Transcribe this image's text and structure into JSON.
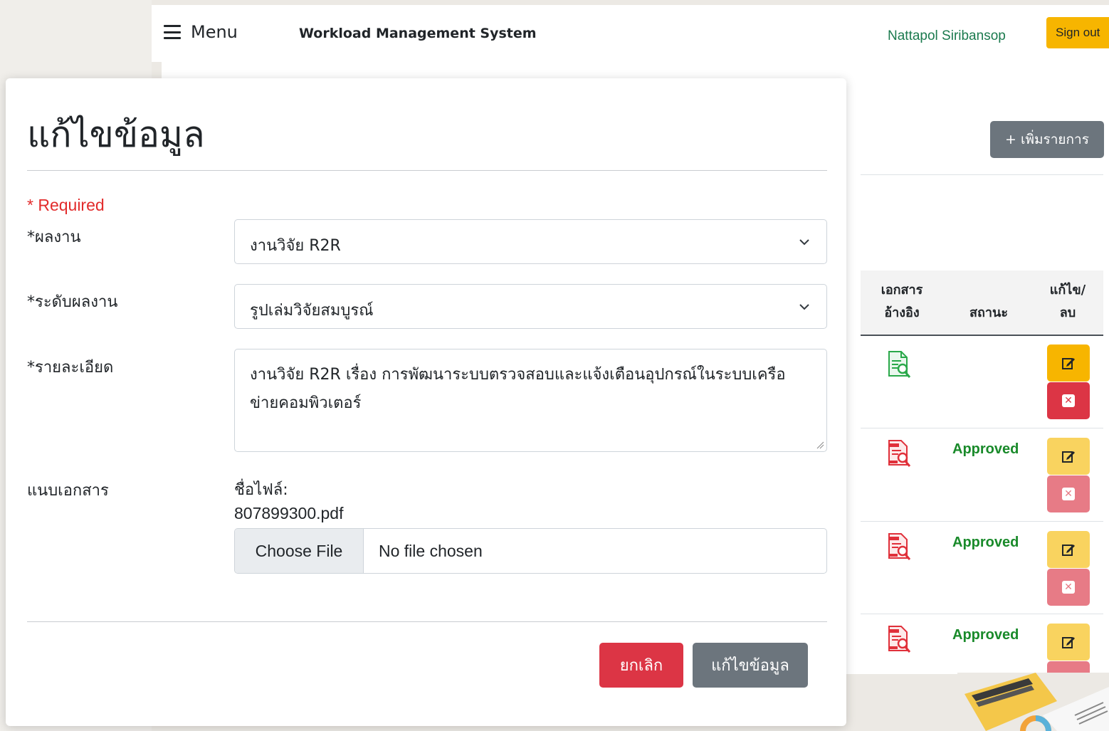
{
  "navbar": {
    "menu_label": "Menu",
    "app_title": "Workload Management System",
    "user_name": "Nattapol Siribansop",
    "signout_label": "Sign out"
  },
  "background_page": {
    "add_button": "+ เพิ่มรายการ",
    "table": {
      "headers": {
        "doc": [
          "เอกสาร",
          "อ้างอิง"
        ],
        "status": "สถานะ",
        "edit": [
          "แก้ไข/",
          "ลบ"
        ]
      },
      "rows": [
        {
          "doc_icon": "green-document-search-icon",
          "status": ""
        },
        {
          "doc_icon": "red-pdf-search-icon",
          "status": "Approved"
        },
        {
          "doc_icon": "red-pdf-search-icon",
          "status": "Approved"
        },
        {
          "doc_icon": "red-pdf-search-icon",
          "status": "Approved"
        }
      ]
    }
  },
  "modal": {
    "title": "แก้ไขข้อมูล",
    "required_note": "* Required",
    "fields": {
      "work_label": "*ผลงาน",
      "work_value": "งานวิจัย R2R",
      "level_label": "*ระดับผลงาน",
      "level_value": "รูปเล่มวิจัยสมบูรณ์",
      "detail_label": "*รายละเอียด",
      "detail_value": "งานวิจัย R2R เรื่อง การพัฒนาระบบตรวจสอบและแจ้งเตือนอุปกรณ์ในระบบเครือข่ายคอมพิวเตอร์",
      "attach_label": "แนบเอกสาร",
      "file_name_label": "ชื่อไฟล์:",
      "file_name": "807899300.pdf",
      "choose_file": "Choose File",
      "no_file": "No file chosen"
    },
    "buttons": {
      "cancel": "ยกเลิก",
      "save": "แก้ไขข้อมูล"
    }
  },
  "colors": {
    "signout": "#f7b500",
    "approved": "#198a2a",
    "cancel": "#dc3545",
    "secondary": "#6c757d",
    "required": "#e22c2c",
    "user_name": "#1b7a4e"
  }
}
